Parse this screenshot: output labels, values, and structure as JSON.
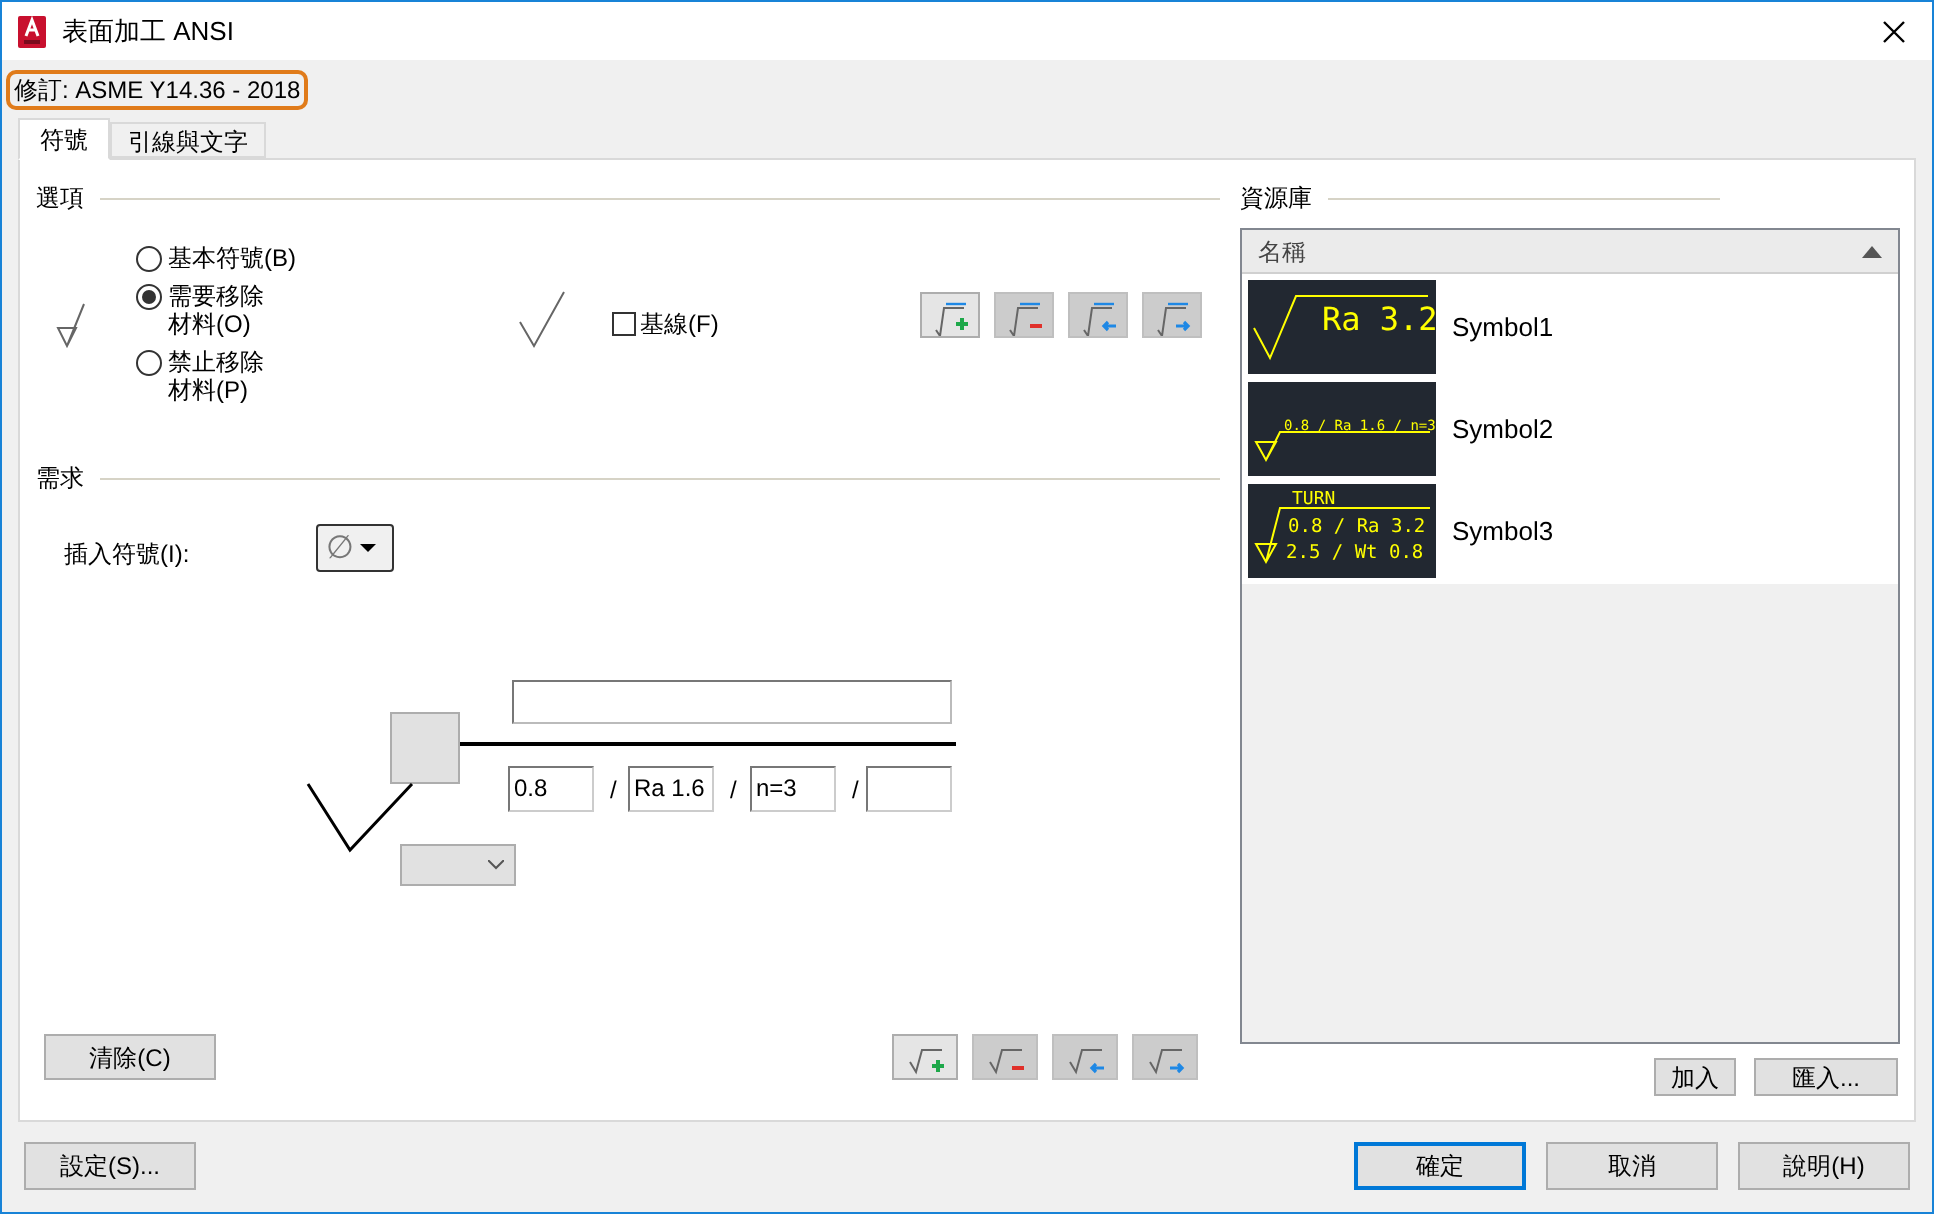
{
  "window": {
    "title": "表面加工 ANSI"
  },
  "revision": "修訂: ASME Y14.36 - 2018",
  "tabs": [
    {
      "label": "符號",
      "selected": true
    },
    {
      "label": "引線與文字",
      "selected": false
    }
  ],
  "options": {
    "title": "選項",
    "radios": [
      {
        "label": "基本符號(B)",
        "selected": false
      },
      {
        "label": "需要移除材料(O)",
        "selected": true
      },
      {
        "label": "禁止移除材料(P)",
        "selected": false
      }
    ],
    "baseline": {
      "label": "基線(F)",
      "checked": false
    },
    "buttons": [
      {
        "kind": "add",
        "disabled": false
      },
      {
        "kind": "remove",
        "disabled": true
      },
      {
        "kind": "left",
        "disabled": true
      },
      {
        "kind": "right",
        "disabled": true
      }
    ]
  },
  "requirements": {
    "title": "需求",
    "insert_label": "插入符號(I):",
    "insert_symbol": "∅",
    "values": [
      "0.8",
      "Ra 1.6",
      "n=3"
    ],
    "separators": [
      "/",
      "/",
      "/"
    ],
    "clear_button": "清除(C)",
    "buttons": [
      {
        "kind": "add",
        "disabled": false
      },
      {
        "kind": "remove",
        "disabled": true
      },
      {
        "kind": "left",
        "disabled": true
      },
      {
        "kind": "right",
        "disabled": true
      }
    ]
  },
  "library": {
    "title": "資源庫",
    "column": "名稱",
    "items": [
      {
        "name": "Symbol1",
        "preview": {
          "kind": "basic",
          "lines": [
            "Ra 3.2"
          ]
        }
      },
      {
        "name": "Symbol2",
        "preview": {
          "kind": "removal",
          "lines": [
            "0.8 / Ra 1.6 / n=3"
          ]
        }
      },
      {
        "name": "Symbol3",
        "preview": {
          "kind": "removal",
          "lines": [
            "TURN",
            "0.8 / Ra 3.2",
            "2.5 / Wt 0.8"
          ]
        }
      }
    ],
    "buttons": [
      "加入",
      "匯入..."
    ]
  },
  "footer": {
    "settings": "設定(S)...",
    "buttons": [
      {
        "label": "確定",
        "default": true
      },
      {
        "label": "取消",
        "default": false
      },
      {
        "label": "說明(H)",
        "default": false
      }
    ]
  }
}
